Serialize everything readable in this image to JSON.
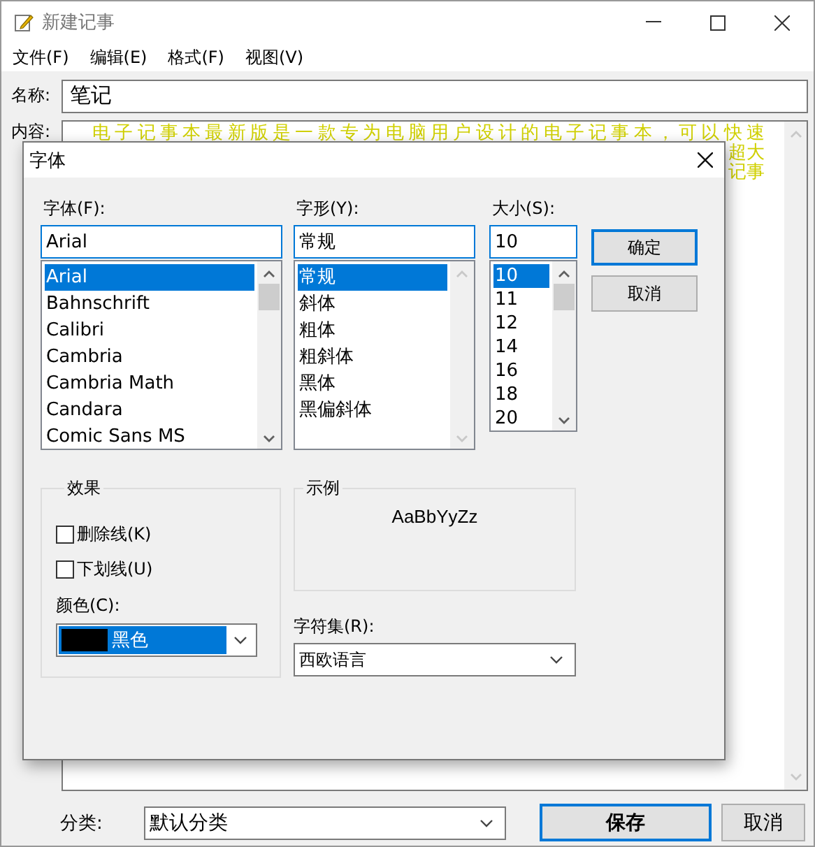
{
  "window": {
    "title": "新建记事",
    "menu": [
      "文件(F)",
      "编辑(E)",
      "格式(F)",
      "视图(V)"
    ],
    "name_label": "名称:",
    "name_value": "笔记",
    "content_label": "内容:",
    "content_lines": [
      "电子记事本最新版是一款专为电脑用户设计的电子记事本，可以快速",
      "超大",
      "记事"
    ]
  },
  "font_dialog": {
    "title": "字体",
    "font_label": "字体(F):",
    "font_value": "Arial",
    "fonts": [
      {
        "label": "Arial",
        "selected": true
      },
      {
        "label": "Bahnschrift",
        "selected": false
      },
      {
        "label": "Calibri",
        "selected": false
      },
      {
        "label": "Cambria",
        "selected": false
      },
      {
        "label": "Cambria Math",
        "selected": false
      },
      {
        "label": "Candara",
        "selected": false
      },
      {
        "label": "Comic Sans MS",
        "selected": false
      }
    ],
    "style_label": "字形(Y):",
    "style_value": "常规",
    "styles": [
      {
        "label": "常规",
        "selected": true
      },
      {
        "label": "斜体",
        "selected": false
      },
      {
        "label": "粗体",
        "selected": false
      },
      {
        "label": "粗斜体",
        "selected": false
      },
      {
        "label": "黑体",
        "selected": false
      },
      {
        "label": "黑偏斜体",
        "selected": false
      }
    ],
    "size_label": "大小(S):",
    "size_value": "10",
    "sizes": [
      {
        "label": "10",
        "selected": true
      },
      {
        "label": "11",
        "selected": false
      },
      {
        "label": "12",
        "selected": false
      },
      {
        "label": "14",
        "selected": false
      },
      {
        "label": "16",
        "selected": false
      },
      {
        "label": "18",
        "selected": false
      },
      {
        "label": "20",
        "selected": false
      }
    ],
    "ok": "确定",
    "cancel": "取消",
    "effects_title": "效果",
    "effects": [
      {
        "label": "删除线(K)",
        "checked": false
      },
      {
        "label": "下划线(U)",
        "checked": false
      }
    ],
    "color_label": "颜色(C):",
    "color_value": {
      "label": "黑色",
      "color": "#000000"
    },
    "sample_title": "示例",
    "sample_text": "AaBbYyZz",
    "charset_label": "字符集(R):",
    "charset_value": "西欧语言"
  },
  "bottom": {
    "category_label": "分类:",
    "category_value": "默认分类",
    "save": "保存",
    "cancel": "取消"
  }
}
